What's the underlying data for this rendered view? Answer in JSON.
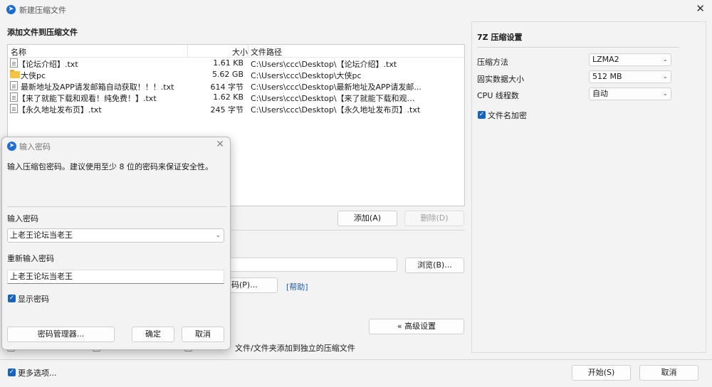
{
  "window": {
    "title": "新建压缩文件",
    "close_glyph": "✕"
  },
  "add_files": {
    "heading": "添加文件到压缩文件",
    "columns": {
      "name": "名称",
      "size": "大小",
      "path": "文件路径"
    },
    "rows": [
      {
        "name": "【论坛介绍】.txt",
        "size": "1.61 KB",
        "path": "C:\\Users\\ccc\\Desktop\\【论坛介绍】.txt",
        "icon": "file-icon"
      },
      {
        "name": "大侠pc",
        "size": "5.62 GB",
        "path": "C:\\Users\\ccc\\Desktop\\大侠pc",
        "icon": "folder-icon"
      },
      {
        "name": "最新地址及APP请发邮箱自动获取！！！.txt",
        "size": "614 字节",
        "path": "C:\\Users\\ccc\\Desktop\\最新地址及APP请发邮...",
        "icon": "file-icon"
      },
      {
        "name": "【来了就能下载和观看！纯免费！】.txt",
        "size": "1.62 KB",
        "path": "C:\\Users\\ccc\\Desktop\\【来了就能下载和观看...",
        "icon": "file-icon"
      },
      {
        "name": "【永久地址发布页】.txt",
        "size": "245 字节",
        "path": "C:\\Users\\ccc\\Desktop\\【永久地址发布页】.txt",
        "icon": "file-icon"
      }
    ],
    "add_button": "添加(A)",
    "delete_button": "删除(D)"
  },
  "archive": {
    "browse_button": "浏览(B)...",
    "password_button_partial": "码(P)...",
    "help_link": "[帮助]",
    "advanced_button": "« 高级设置",
    "separate_archive_label": "文件/文件夹添加到独立的压缩文件"
  },
  "settings_7z": {
    "heading": "7Z 压缩设置",
    "method_label": "压缩方法",
    "method_value": "LZMA2",
    "dict_label": "固实数据大小",
    "dict_value": "512 MB",
    "threads_label": "CPU 线程数",
    "threads_value": "自动",
    "encrypt_names_label": "文件名加密",
    "encrypt_names_checked": true
  },
  "footer": {
    "more_options_label": "更多选项...",
    "start_button": "开始(S)",
    "cancel_button": "取消"
  },
  "password_dialog": {
    "title": "输入密码",
    "message": "输入压缩包密码。建议使用至少 8 位的密码来保证安全性。",
    "password_label": "输入密码",
    "password_value": "上老王论坛当老王",
    "confirm_label": "重新输入密码",
    "confirm_value": "上老王论坛当老王",
    "show_password_label": "显示密码",
    "show_password_checked": true,
    "manager_button": "密码管理器...",
    "ok_button": "确定",
    "cancel_button": "取消"
  },
  "colors": {
    "accent": "#1565c0",
    "link": "#1a5fb4",
    "folder": "#f5c443"
  }
}
